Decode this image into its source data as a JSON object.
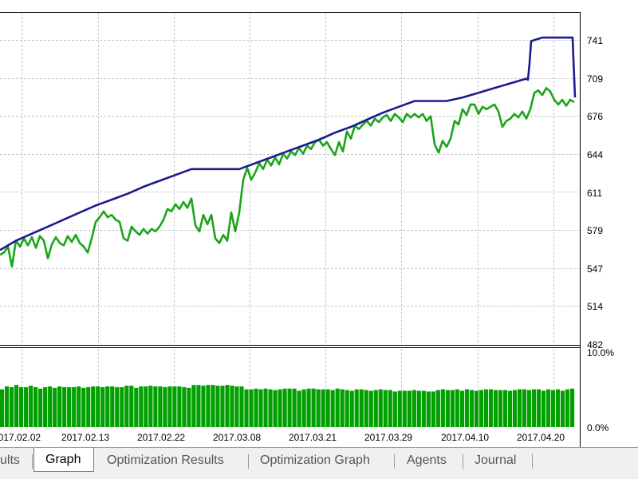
{
  "tabs": {
    "results_label": "ults",
    "graph_label": "Graph",
    "optimization_results_label": "Optimization Results",
    "optimization_graph_label": "Optimization Graph",
    "agents_label": "Agents",
    "journal_label": "Journal",
    "active": "Graph"
  },
  "colors": {
    "balance": "#1b1b8f",
    "equity": "#1aa51a",
    "deposit_load": "#00a000",
    "grid": "#c8c8c8"
  },
  "chart_data": [
    {
      "type": "line",
      "series": [
        {
          "role": "balance",
          "values": [
            [
              0,
              562
            ],
            [
              20,
              570
            ],
            [
              40,
              576
            ],
            [
              60,
              582
            ],
            [
              80,
              588
            ],
            [
              100,
              594
            ],
            [
              120,
              600
            ],
            [
              140,
              605
            ],
            [
              160,
              610
            ],
            [
              180,
              616
            ],
            [
              200,
              621
            ],
            [
              220,
              626
            ],
            [
              240,
              631
            ],
            [
              260,
              631
            ],
            [
              280,
              631
            ],
            [
              300,
              631
            ],
            [
              320,
              636
            ],
            [
              340,
              641
            ],
            [
              360,
              646
            ],
            [
              380,
              651
            ],
            [
              400,
              656
            ],
            [
              420,
              662
            ],
            [
              440,
              667
            ],
            [
              460,
              673
            ],
            [
              480,
              679
            ],
            [
              500,
              684
            ],
            [
              520,
              689
            ],
            [
              540,
              689
            ],
            [
              560,
              689
            ],
            [
              580,
              692
            ],
            [
              600,
              696
            ],
            [
              620,
              700
            ],
            [
              640,
              704
            ],
            [
              660,
              708
            ],
            [
              662,
              707
            ],
            [
              664,
              721
            ],
            [
              666,
              740
            ],
            [
              680,
              743
            ],
            [
              700,
              743
            ],
            [
              718,
              743
            ],
            [
              719,
              725
            ],
            [
              721,
              692
            ]
          ]
        },
        {
          "role": "equity",
          "values": [
            [
              0,
              558
            ],
            [
              5,
              560
            ],
            [
              10,
              565
            ],
            [
              15,
              548
            ],
            [
              20,
              570
            ],
            [
              25,
              565
            ],
            [
              30,
              572
            ],
            [
              35,
              566
            ],
            [
              40,
              573
            ],
            [
              45,
              564
            ],
            [
              50,
              574
            ],
            [
              55,
              570
            ],
            [
              60,
              555
            ],
            [
              65,
              567
            ],
            [
              70,
              573
            ],
            [
              75,
              568
            ],
            [
              80,
              566
            ],
            [
              85,
              574
            ],
            [
              90,
              569
            ],
            [
              95,
              575
            ],
            [
              100,
              568
            ],
            [
              105,
              565
            ],
            [
              110,
              560
            ],
            [
              115,
              572
            ],
            [
              120,
              586
            ],
            [
              125,
              590
            ],
            [
              130,
              595
            ],
            [
              135,
              590
            ],
            [
              140,
              592
            ],
            [
              145,
              588
            ],
            [
              150,
              586
            ],
            [
              155,
              572
            ],
            [
              160,
              570
            ],
            [
              165,
              582
            ],
            [
              170,
              578
            ],
            [
              175,
              575
            ],
            [
              180,
              580
            ],
            [
              185,
              576
            ],
            [
              190,
              580
            ],
            [
              195,
              578
            ],
            [
              200,
              582
            ],
            [
              205,
              588
            ],
            [
              210,
              597
            ],
            [
              215,
              595
            ],
            [
              220,
              601
            ],
            [
              225,
              597
            ],
            [
              230,
              603
            ],
            [
              235,
              598
            ],
            [
              240,
              606
            ],
            [
              245,
              583
            ],
            [
              250,
              578
            ],
            [
              255,
              592
            ],
            [
              260,
              584
            ],
            [
              265,
              592
            ],
            [
              270,
              572
            ],
            [
              275,
              568
            ],
            [
              280,
              575
            ],
            [
              285,
              570
            ],
            [
              290,
              594
            ],
            [
              295,
              578
            ],
            [
              300,
              594
            ],
            [
              305,
              622
            ],
            [
              310,
              632
            ],
            [
              315,
              622
            ],
            [
              320,
              628
            ],
            [
              325,
              636
            ],
            [
              330,
              631
            ],
            [
              335,
              639
            ],
            [
              340,
              634
            ],
            [
              345,
              641
            ],
            [
              350,
              635
            ],
            [
              355,
              644
            ],
            [
              360,
              640
            ],
            [
              365,
              646
            ],
            [
              370,
              643
            ],
            [
              375,
              649
            ],
            [
              380,
              644
            ],
            [
              385,
              651
            ],
            [
              390,
              648
            ],
            [
              395,
              654
            ],
            [
              400,
              656
            ],
            [
              405,
              651
            ],
            [
              410,
              654
            ],
            [
              415,
              648
            ],
            [
              420,
              643
            ],
            [
              425,
              654
            ],
            [
              430,
              646
            ],
            [
              435,
              663
            ],
            [
              440,
              657
            ],
            [
              445,
              668
            ],
            [
              450,
              665
            ],
            [
              455,
              669
            ],
            [
              460,
              672
            ],
            [
              465,
              668
            ],
            [
              470,
              674
            ],
            [
              475,
              671
            ],
            [
              480,
              675
            ],
            [
              485,
              677
            ],
            [
              490,
              672
            ],
            [
              495,
              678
            ],
            [
              500,
              675
            ],
            [
              505,
              671
            ],
            [
              510,
              678
            ],
            [
              515,
              675
            ],
            [
              520,
              678
            ],
            [
              525,
              675
            ],
            [
              530,
              678
            ],
            [
              535,
              672
            ],
            [
              540,
              676
            ],
            [
              545,
              652
            ],
            [
              550,
              645
            ],
            [
              555,
              655
            ],
            [
              560,
              650
            ],
            [
              565,
              657
            ],
            [
              570,
              672
            ],
            [
              575,
              669
            ],
            [
              580,
              682
            ],
            [
              585,
              677
            ],
            [
              590,
              686
            ],
            [
              595,
              686
            ],
            [
              600,
              678
            ],
            [
              605,
              684
            ],
            [
              610,
              682
            ],
            [
              615,
              684
            ],
            [
              620,
              686
            ],
            [
              625,
              680
            ],
            [
              630,
              667
            ],
            [
              635,
              672
            ],
            [
              640,
              674
            ],
            [
              645,
              678
            ],
            [
              650,
              675
            ],
            [
              655,
              680
            ],
            [
              660,
              674
            ],
            [
              665,
              682
            ],
            [
              670,
              696
            ],
            [
              675,
              698
            ],
            [
              680,
              694
            ],
            [
              685,
              700
            ],
            [
              690,
              697
            ],
            [
              695,
              690
            ],
            [
              700,
              686
            ],
            [
              705,
              690
            ],
            [
              710,
              685
            ],
            [
              715,
              690
            ],
            [
              720,
              688
            ]
          ]
        }
      ],
      "ytick_labels": [
        "741",
        "709",
        "676",
        "644",
        "611",
        "579",
        "547",
        "514",
        "482"
      ],
      "ylim": [
        482,
        741
      ],
      "xlim": [
        0,
        721
      ],
      "grid": true
    },
    {
      "type": "bar",
      "role": "deposit_load",
      "ytick_labels": [
        "10.0%",
        "0.0%"
      ],
      "ylim": [
        0,
        10
      ],
      "x_tick_labels": [
        "2017.02.02",
        "2017.02.13",
        "2017.02.22",
        "2017.03.08",
        "2017.03.21",
        "2017.03.29",
        "2017.04.10",
        "2017.04.20"
      ],
      "values": [
        5.2,
        5.6,
        5.5,
        5.8,
        5.5,
        5.5,
        5.7,
        5.5,
        5.3,
        5.5,
        5.6,
        5.4,
        5.6,
        5.5,
        5.5,
        5.5,
        5.6,
        5.4,
        5.5,
        5.6,
        5.6,
        5.5,
        5.6,
        5.6,
        5.5,
        5.5,
        5.7,
        5.7,
        5.4,
        5.6,
        5.6,
        5.7,
        5.6,
        5.6,
        5.5,
        5.6,
        5.6,
        5.6,
        5.5,
        5.4,
        5.8,
        5.8,
        5.7,
        5.8,
        5.8,
        5.7,
        5.7,
        5.8,
        5.7,
        5.6,
        5.6,
        5.2,
        5.2,
        5.3,
        5.2,
        5.3,
        5.2,
        5.1,
        5.2,
        5.3,
        5.3,
        5.3,
        5.0,
        5.2,
        5.3,
        5.3,
        5.2,
        5.2,
        5.2,
        5.1,
        5.3,
        5.2,
        5.1,
        5.0,
        5.2,
        5.2,
        5.1,
        5.0,
        5.1,
        5.2,
        5.1,
        5.1,
        4.9,
        5.0,
        5.0,
        5.0,
        5.1,
        5.0,
        5.0,
        4.9,
        4.9,
        5.1,
        5.2,
        5.1,
        5.1,
        5.2,
        5.0,
        5.2,
        5.1,
        5.0,
        5.1,
        5.2,
        5.2,
        5.1,
        5.1,
        5.1,
        5.0,
        5.1,
        5.2,
        5.2,
        5.1,
        5.2,
        5.2,
        5.0,
        5.2,
        5.1,
        5.2,
        5.0,
        5.2,
        5.3
      ]
    }
  ]
}
